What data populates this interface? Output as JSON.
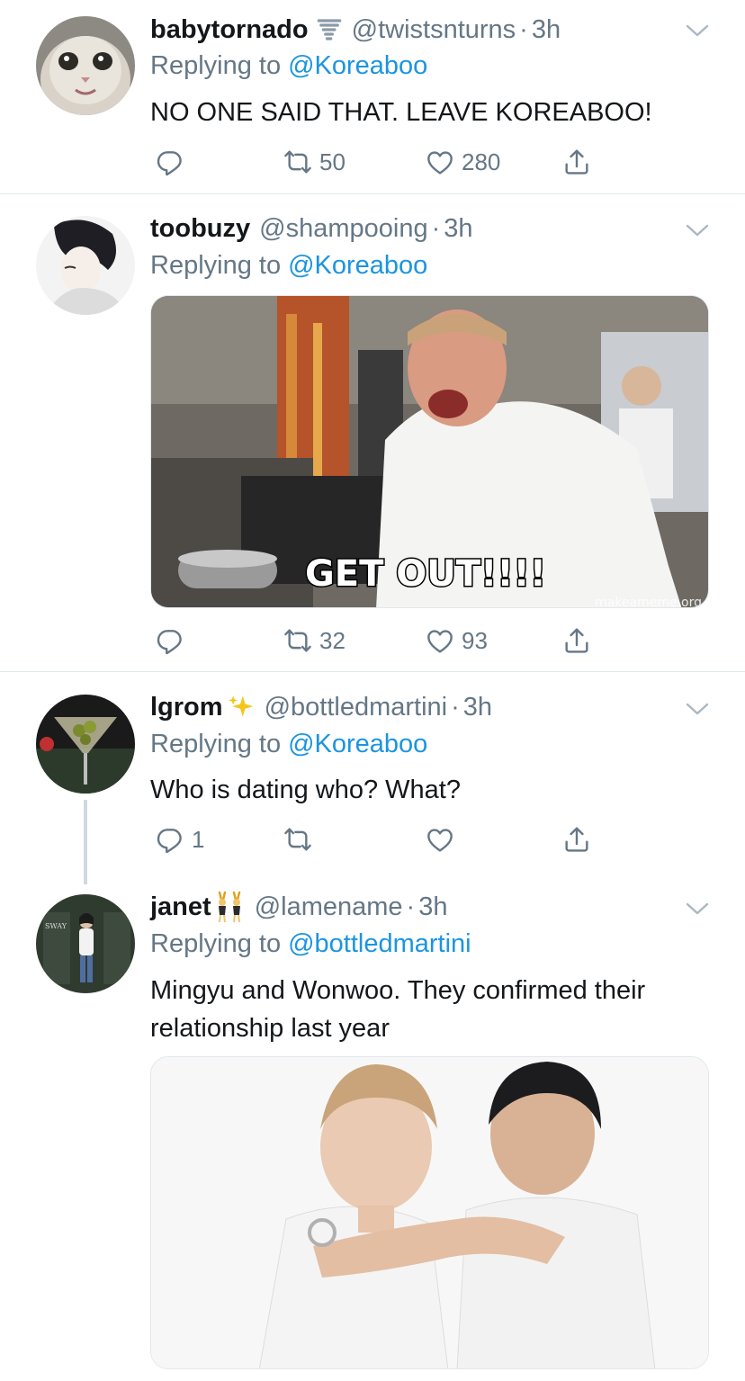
{
  "tweets": [
    {
      "name": "babytornado",
      "handle": "@twistsnturns",
      "time": "3h",
      "reply_prefix": "Replying to",
      "reply_to": "@Koreaboo",
      "text": "NO ONE SAID THAT. LEAVE KOREABOO!",
      "reply_count": "",
      "retweet_count": "50",
      "like_count": "280"
    },
    {
      "name": "toobuzy",
      "handle": "@shampooing",
      "time": "3h",
      "reply_prefix": "Replying to",
      "reply_to": "@Koreaboo",
      "media_caption": "GET OUT!!!!",
      "media_watermark": "makeameme.org",
      "reply_count": "",
      "retweet_count": "32",
      "like_count": "93"
    },
    {
      "name": "lgrom",
      "handle": "@bottledmartini",
      "time": "3h",
      "reply_prefix": "Replying to",
      "reply_to": "@Koreaboo",
      "text": "Who is dating who? What?",
      "reply_count": "1",
      "retweet_count": "",
      "like_count": ""
    },
    {
      "name": "janet",
      "handle": "@lamename",
      "time": "3h",
      "reply_prefix": "Replying to",
      "reply_to": "@bottledmartini",
      "text": "Mingyu and Wonwoo. They confirmed their relationship last year"
    }
  ],
  "icons": {
    "reply": "reply-icon",
    "retweet": "retweet-icon",
    "like": "heart-icon",
    "share": "share-icon",
    "more": "chevron-down-icon",
    "tornado_emoji": "tornado-emoji-icon",
    "sparkles_emoji": "sparkles-emoji-icon",
    "dancers_emoji": "bunny-dancers-emoji-icon"
  },
  "colors": {
    "link": "#1b95e0",
    "muted": "#657786",
    "text": "#14171a",
    "divider": "#e1e8ed"
  }
}
